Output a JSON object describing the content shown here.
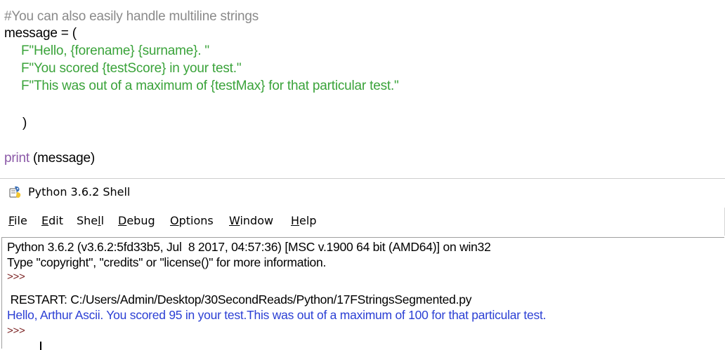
{
  "editor": {
    "comment": "#You can also easily handle multiline strings",
    "assign": "message = (",
    "str1": "F\"Hello, {forename} {surname}. \"",
    "str2": "F\"You scored {testScore} in your test.\"",
    "str3": "F\"This was out of a maximum of {testMax} for that particular test.\"",
    "close": ")",
    "print_kw": "print",
    "print_args": " (message)"
  },
  "shell": {
    "title": "Python 3.6.2 Shell",
    "icon": "python-idle-icon",
    "menu": [
      {
        "label": "File",
        "acc": "F",
        "rest": "ile"
      },
      {
        "label": "Edit",
        "acc": "E",
        "rest": "dit"
      },
      {
        "label": "Shell",
        "pre": "She",
        "acc": "l",
        "rest": "l"
      },
      {
        "label": "Debug",
        "acc": "D",
        "rest": "ebug"
      },
      {
        "label": "Options",
        "acc": "O",
        "rest": "ptions"
      },
      {
        "label": "Window",
        "acc": "W",
        "rest": "indow"
      },
      {
        "label": "Help",
        "acc": "H",
        "rest": "elp"
      }
    ],
    "banner1": "Python 3.6.2 (v3.6.2:5fd33b5, Jul  8 2017, 04:57:36) [MSC v.1900 64 bit (AMD64)] on win32",
    "banner2": "Type \"copyright\", \"credits\" or \"license()\" for more information.",
    "prompt1": ">>>",
    "restart": " RESTART: C:/Users/Admin/Desktop/30SecondReads/Python/17FStringsSegmented.py",
    "result": "Hello, Arthur Ascii. You scored 95 in your test.This was out of a maximum of 100 for that particular test.",
    "prompt2": ">>>"
  }
}
